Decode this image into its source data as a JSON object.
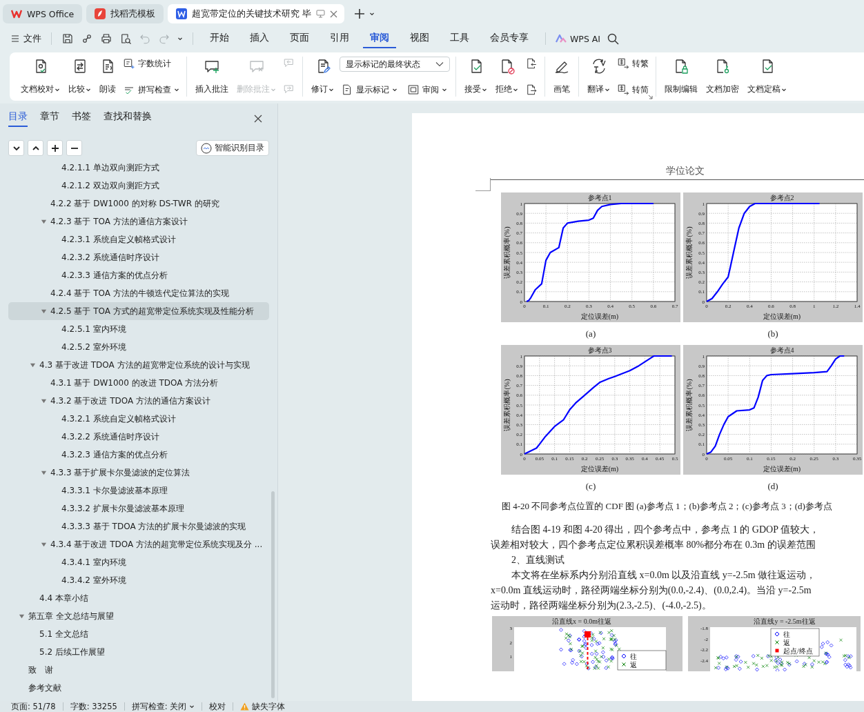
{
  "tabs": [
    {
      "label": "WPS Office",
      "kind": "wps",
      "selected": false
    },
    {
      "label": "找稻壳模板",
      "kind": "docer",
      "selected": false
    },
    {
      "label": "超宽带定位的关键技术研究 毕",
      "kind": "writer",
      "selected": true
    }
  ],
  "quick_access": [
    {
      "kind": "save",
      "disabled": false
    },
    {
      "kind": "link",
      "disabled": false
    },
    {
      "kind": "print",
      "disabled": false
    },
    {
      "kind": "preview",
      "disabled": false
    },
    {
      "kind": "undo",
      "disabled": true
    },
    {
      "kind": "redo",
      "disabled": true
    }
  ],
  "menu": {
    "file": "文件",
    "ai": "WPS AI",
    "tabs": [
      {
        "label": "开始",
        "selected": false
      },
      {
        "label": "插入",
        "selected": false
      },
      {
        "label": "页面",
        "selected": false
      },
      {
        "label": "引用",
        "selected": false
      },
      {
        "label": "审阅",
        "selected": true
      },
      {
        "label": "视图",
        "selected": false
      },
      {
        "label": "工具",
        "selected": false
      },
      {
        "label": "会员专享",
        "selected": false
      }
    ]
  },
  "ribbon": [
    {
      "columns": [
        {
          "label": "文档校对",
          "kind": "proof",
          "dropdown": true,
          "disabled": false
        },
        {
          "label": "比较",
          "kind": "compare",
          "dropdown": true,
          "disabled": false
        },
        {
          "label": "朗读",
          "kind": "read",
          "dropdown": false,
          "disabled": false
        },
        {
          "items": [
            {
              "label": "字数统计",
              "kind": "count",
              "dropdown": false,
              "disabled": false
            },
            {
              "label": "拼写检查",
              "kind": "spell",
              "dropdown": true,
              "disabled": false
            }
          ]
        }
      ]
    },
    {
      "columns": [
        {
          "label": "插入批注",
          "kind": "comment-add",
          "dropdown": false,
          "disabled": false
        },
        {
          "label": "删除批注",
          "kind": "comment-delete",
          "dropdown": true,
          "disabled": true
        },
        {
          "items": [
            {
              "kind": "comment-prev",
              "dropdown": false,
              "disabled": true
            },
            {
              "kind": "comment-next",
              "dropdown": false,
              "disabled": true
            }
          ]
        }
      ]
    },
    {
      "columns": [
        {
          "label": "修订",
          "kind": "track",
          "dropdown": true,
          "disabled": false
        },
        {
          "value": "显示标记的最终状态",
          "items": [
            {
              "label": "显示标记",
              "kind": "markup",
              "dropdown": true,
              "disabled": false
            },
            {
              "label": "审阅",
              "kind": "pane",
              "dropdown": true,
              "disabled": false
            }
          ]
        }
      ]
    },
    {
      "columns": [
        {
          "label": "接受",
          "kind": "accept",
          "dropdown": true,
          "disabled": false
        },
        {
          "label": "拒绝",
          "kind": "reject",
          "dropdown": true,
          "disabled": false
        },
        {
          "items": [
            {
              "kind": "change-prev",
              "dropdown": false,
              "disabled": false
            },
            {
              "kind": "change-next",
              "dropdown": false,
              "disabled": false
            }
          ]
        }
      ]
    },
    {
      "columns": [
        {
          "label": "画笔",
          "kind": "pen",
          "dropdown": false,
          "disabled": false
        }
      ]
    },
    {
      "launcher": true,
      "columns": [
        {
          "label": "翻译",
          "kind": "translate",
          "dropdown": true,
          "disabled": false
        },
        {
          "items": [
            {
              "label": "转繁",
              "kind": "trad",
              "dropdown": false,
              "disabled": false
            },
            {
              "label": "转简",
              "kind": "simp",
              "dropdown": false,
              "disabled": false
            }
          ]
        }
      ]
    },
    {
      "columns": [
        {
          "label": "限制编辑",
          "kind": "lock",
          "dropdown": false,
          "disabled": false
        },
        {
          "label": "文档加密",
          "kind": "key",
          "dropdown": false,
          "disabled": false
        },
        {
          "label": "文档定稿",
          "kind": "final",
          "dropdown": true,
          "disabled": false
        }
      ]
    }
  ],
  "sidebar": {
    "tabs": [
      {
        "label": "目录",
        "selected": true
      },
      {
        "label": "章节",
        "selected": false
      },
      {
        "label": "书签",
        "selected": false
      },
      {
        "label": "查找和替换",
        "selected": false
      }
    ],
    "smart_button": "智能识别目录",
    "toc": [
      {
        "children": [
          {
            "children": [
              {
                "children": [
                  {
                    "label": "4.2.1.1  单边双向测距方式",
                    "selected": false
                  },
                  {
                    "label": "4.2.1.2  双边双向测距方式",
                    "selected": false
                  }
                ]
              },
              {
                "label": "4.2.2  基于 DW1000 的对称 DS-TWR 的研究",
                "selected": false
              },
              {
                "label": "4.2.3  基于 TOA 方法的通信方案设计",
                "selected": false,
                "expanded": true,
                "children": [
                  {
                    "label": "4.2.3.1  系统自定义帧格式设计",
                    "selected": false
                  },
                  {
                    "label": "4.2.3.2  系统通信时序设计",
                    "selected": false
                  },
                  {
                    "label": "4.2.3.3  通信方案的优点分析",
                    "selected": false
                  }
                ]
              },
              {
                "label": "4.2.4  基于 TOA 方法的牛顿迭代定位算法的实现",
                "selected": false
              },
              {
                "label": "4.2.5  基于 TOA 方式的超宽带定位系统实现及性能分析",
                "selected": true,
                "expanded": true,
                "children": [
                  {
                    "label": "4.2.5.1  室内环境",
                    "selected": false
                  },
                  {
                    "label": "4.2.5.2  室外环境",
                    "selected": false
                  }
                ]
              }
            ]
          },
          {
            "label": "4.3  基于改进 TDOA 方法的超宽带定位系统的设计与实现",
            "selected": false,
            "expanded": true,
            "children": [
              {
                "label": "4.3.1  基于 DW1000 的改进 TDOA 方法分析",
                "selected": false
              },
              {
                "label": "4.3.2  基于改进 TDOA 方法的通信方案设计",
                "selected": false,
                "expanded": true,
                "children": [
                  {
                    "label": "4.3.2.1  系统自定义帧格式设计",
                    "selected": false
                  },
                  {
                    "label": "4.3.2.2  系统通信时序设计",
                    "selected": false
                  },
                  {
                    "label": "4.3.2.3  通信方案的优点分析",
                    "selected": false
                  }
                ]
              },
              {
                "label": "4.3.3  基于扩展卡尔曼滤波的定位算法",
                "selected": false,
                "expanded": true,
                "children": [
                  {
                    "label": "4.3.3.1  卡尔曼滤波基本原理",
                    "selected": false
                  },
                  {
                    "label": "4.3.3.2  扩展卡尔曼滤波基本原理",
                    "selected": false
                  },
                  {
                    "label": "4.3.3.3  基于 TDOA 方法的扩展卡尔曼滤波的实现",
                    "selected": false
                  }
                ]
              },
              {
                "label": "4.3.4  基于改进 TDOA 方法的超宽带定位系统实现及分 ...",
                "selected": false,
                "expanded": true,
                "children": [
                  {
                    "label": "4.3.4.1  室内环境",
                    "selected": false
                  },
                  {
                    "label": "4.3.4.2  室外环境",
                    "selected": false
                  }
                ]
              }
            ]
          },
          {
            "label": "4.4  本章小结",
            "selected": false
          }
        ]
      },
      {
        "label": "第五章  全文总结与展望",
        "selected": false,
        "expanded": true,
        "children": [
          {
            "label": "5.1  全文总结",
            "selected": false
          },
          {
            "label": "5.2  后续工作展望",
            "selected": false
          }
        ]
      },
      {
        "label": "致　谢",
        "selected": false
      },
      {
        "label": "参考文献",
        "selected": false
      }
    ]
  },
  "document": {
    "header": "学位论文",
    "figures": [
      {
        "caption": "(a)",
        "chart_data": {
          "type": "line",
          "title": "参考点1",
          "grid": true,
          "xlabel": "定位误差(m)",
          "ylabel": "误差累积概率(%)",
          "xlim": [
            0,
            0.7
          ],
          "ylim": [
            0,
            1
          ],
          "xticks": [
            0,
            0.1,
            0.2,
            0.3,
            0.4,
            0.5,
            0.6,
            0.7
          ],
          "yticks": [
            0,
            0.1,
            0.2,
            0.3,
            0.4,
            0.5,
            0.6,
            0.7,
            0.8,
            0.9,
            1
          ],
          "x": [
            0.01,
            0.02,
            0.03,
            0.05,
            0.08,
            0.1,
            0.12,
            0.16,
            0.18,
            0.2,
            0.25,
            0.3,
            0.32,
            0.34,
            0.36,
            0.4,
            0.45,
            0.6
          ],
          "series": [
            {
              "color": "#0000ff",
              "values": [
                0,
                0.01,
                0.04,
                0.12,
                0.18,
                0.42,
                0.5,
                0.55,
                0.75,
                0.8,
                0.82,
                0.83,
                0.85,
                0.93,
                0.97,
                0.99,
                1,
                1
              ]
            }
          ]
        }
      },
      {
        "caption": "(b)",
        "chart_data": {
          "type": "line",
          "title": "参考点2",
          "grid": true,
          "xlabel": "定位误差(m)",
          "ylabel": "误差累积概率(%)",
          "xlim": [
            0,
            1.4
          ],
          "ylim": [
            0,
            1
          ],
          "xticks": [
            0,
            0.2,
            0.4,
            0.6,
            0.8,
            1,
            1.2,
            1.4
          ],
          "yticks": [
            0,
            0.1,
            0.2,
            0.3,
            0.4,
            0.5,
            0.6,
            0.7,
            0.8,
            0.9,
            1
          ],
          "x": [
            0,
            0.05,
            0.1,
            0.15,
            0.2,
            0.22,
            0.25,
            0.3,
            0.35,
            0.4,
            0.45,
            0.5,
            1.05
          ],
          "series": [
            {
              "color": "#0000ff",
              "values": [
                0,
                0.03,
                0.1,
                0.18,
                0.25,
                0.35,
                0.5,
                0.75,
                0.9,
                0.97,
                1,
                1,
                1
              ]
            }
          ]
        }
      },
      {
        "caption": "(c)",
        "chart_data": {
          "type": "line",
          "title": "参考点3",
          "grid": true,
          "xlabel": "定位误差(m)",
          "ylabel": "误差累积概率(%)",
          "xlim": [
            0,
            0.5
          ],
          "ylim": [
            0,
            1
          ],
          "xticks": [
            0,
            0.05,
            0.1,
            0.15,
            0.2,
            0.25,
            0.3,
            0.35,
            0.4,
            0.45,
            0.5
          ],
          "yticks": [
            0,
            0.1,
            0.2,
            0.3,
            0.4,
            0.5,
            0.6,
            0.7,
            0.8,
            0.9,
            1
          ],
          "x": [
            0,
            0.04,
            0.05,
            0.07,
            0.1,
            0.13,
            0.15,
            0.17,
            0.2,
            0.23,
            0.25,
            0.28,
            0.3,
            0.35,
            0.38,
            0.42,
            0.43,
            0.49
          ],
          "series": [
            {
              "color": "#0000ff",
              "values": [
                0,
                0.06,
                0.1,
                0.18,
                0.28,
                0.35,
                0.45,
                0.52,
                0.6,
                0.68,
                0.73,
                0.77,
                0.79,
                0.85,
                0.9,
                0.98,
                1,
                1
              ]
            }
          ]
        }
      },
      {
        "caption": "(d)",
        "chart_data": {
          "type": "line",
          "title": "参考点4",
          "grid": true,
          "xlabel": "定位误差(m)",
          "ylabel": "误差累积概率(%)",
          "xlim": [
            0,
            0.35
          ],
          "ylim": [
            0,
            1
          ],
          "xticks": [
            0,
            0.05,
            0.1,
            0.15,
            0.2,
            0.25,
            0.3,
            0.35
          ],
          "yticks": [
            0,
            0.1,
            0.2,
            0.3,
            0.4,
            0.5,
            0.6,
            0.7,
            0.8,
            0.9,
            1
          ],
          "x": [
            0,
            0.01,
            0.02,
            0.03,
            0.04,
            0.05,
            0.07,
            0.1,
            0.11,
            0.12,
            0.13,
            0.14,
            0.15,
            0.2,
            0.25,
            0.28,
            0.29,
            0.3,
            0.31,
            0.32
          ],
          "series": [
            {
              "color": "#0000ff",
              "values": [
                0,
                0.02,
                0.08,
                0.2,
                0.3,
                0.38,
                0.44,
                0.45,
                0.47,
                0.58,
                0.75,
                0.8,
                0.81,
                0.82,
                0.83,
                0.84,
                0.9,
                0.97,
                1,
                1
              ]
            }
          ]
        }
      }
    ],
    "figure_caption": "图 4-20  不同参考点位置的 CDF 图  (a)参考点 1；(b)参考点 2；(c)参考点 3；(d)参考点",
    "lines": [
      {
        "text": "结合图 4-19 和图 4-20 得出，四个参考点中，参考点 1 的 GDOP 值较大，",
        "indent": true
      },
      {
        "text": "误差相对较大，四个参考点定位累积误差概率 80%都分布在 0.3m 的误差范围",
        "indent": false
      },
      {
        "text": "2、直线测试",
        "indent": true
      },
      {
        "text": "本文将在坐标系内分别沿直线 x=0.0m 以及沿直线 y=-2.5m 做往返运动，",
        "indent": true
      },
      {
        "text": "x=0.0m 直线运动时，路径两端坐标分别为(0.0,-2.4)、(0.0,2.4)。当沿 y=-2.5m",
        "indent": false
      },
      {
        "text": "运动时，路径两端坐标分别为(2.3,-2.5)、(-4.0,-2.5)。",
        "indent": false
      }
    ],
    "scatter_figures": [
      {
        "title": "沿直线x = 0.0m往返",
        "y_tick_labels": [
          "3",
          "2",
          "1"
        ],
        "legend": [
          {
            "label": "往",
            "kind": "diamond",
            "color": "#0000ff"
          },
          {
            "label": "返",
            "kind": "cross",
            "color": "#008000"
          }
        ]
      },
      {
        "title": "沿直线y = -2.5m往返",
        "y_tick_labels": [
          "-1.8",
          "-2",
          "-2.2",
          "-2.4"
        ],
        "legend": [
          {
            "label": "往",
            "kind": "diamond",
            "color": "#0000ff"
          },
          {
            "label": "返",
            "kind": "cross",
            "color": "#008000"
          },
          {
            "label": "起点/终点",
            "kind": "square",
            "color": "#ff0000"
          }
        ]
      }
    ]
  },
  "status_bar": [
    {
      "text": "页面: 51/78",
      "kind": "plain"
    },
    {
      "text": "字数: 33255",
      "kind": "plain"
    },
    {
      "text": "拼写检查: 关闭",
      "kind": "dropdown"
    },
    {
      "text": "校对",
      "kind": "plain"
    },
    {
      "text": "缺失字体",
      "kind": "warning"
    }
  ]
}
